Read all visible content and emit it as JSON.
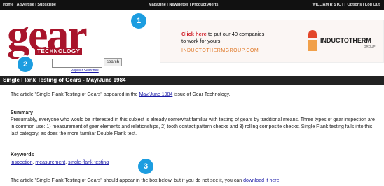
{
  "topbar": {
    "left": "Home | Advertise | Subscribe",
    "middle": "Magazine | Newsletter | Product Alerts",
    "right": "WILLIAM R STOTT   Options | Log Out"
  },
  "logo": {
    "word": "gear",
    "sub": "TECHNOLOGY"
  },
  "search": {
    "button": "search",
    "advanced_link": "Popular Searches"
  },
  "ad": {
    "highlight": "Click here",
    "line1_rest": " to put our 40 companies",
    "line2": "to work for yours.",
    "line3": "INDUCTOTHERMGROUP.COM",
    "brand": "INDUCTOTHERM",
    "brand_sub": "GROUP"
  },
  "title_bar": "Single Flank Testing of Gears - May/June 1984",
  "intro": {
    "before": "The article \"Single Flank Testing of Gears\" appeared in the ",
    "issue_link": "May/June 1984",
    "after": " issue of Gear Technology."
  },
  "summary": {
    "heading": "Summary",
    "body": "Presumably, everyone who would be interested in this subject is already somewhat familiar with testing of gears by traditional means. Three types of gear inspection are in common use: 1) measurement of gear elements and relationships, 2) tooth contact pattern checks and 3) rolling composite checks. Single Flank testing falls into this last category, as does the more familiar Double Flank test."
  },
  "keywords": {
    "heading": "Keywords",
    "items": [
      "inspection",
      "measurement",
      "single-flank testing"
    ]
  },
  "footer": {
    "before": "The article \"Single Flank Testing of Gears\" should appear in the box below, but if you do not see it, you can ",
    "link": "download it here."
  },
  "markers": [
    "1",
    "2",
    "3"
  ]
}
